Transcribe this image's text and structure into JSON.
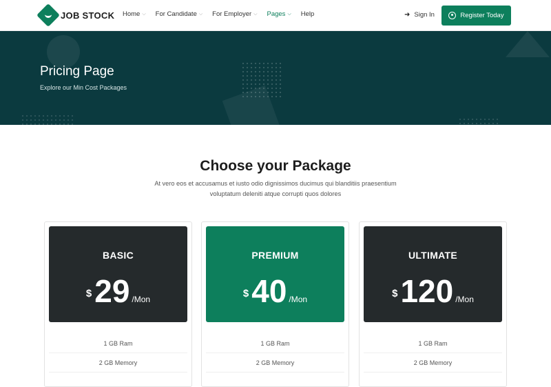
{
  "header": {
    "logo_text": "JOB STOCK",
    "nav": [
      {
        "label": "Home",
        "has_dropdown": true,
        "active": false
      },
      {
        "label": "For Candidate",
        "has_dropdown": true,
        "active": false
      },
      {
        "label": "For Employer",
        "has_dropdown": true,
        "active": false
      },
      {
        "label": "Pages",
        "has_dropdown": true,
        "active": true
      },
      {
        "label": "Help",
        "has_dropdown": false,
        "active": false
      }
    ],
    "signin_label": "Sign In",
    "register_label": "Register Today"
  },
  "hero": {
    "title": "Pricing Page",
    "subtitle": "Explore our Min Cost Packages"
  },
  "section": {
    "title": "Choose your Package",
    "description": "At vero eos et accusamus et iusto odio dignissimos ducimus qui blanditiis praesentium voluptatum deleniti atque corrupti quos dolores"
  },
  "plans": [
    {
      "name": "BASIC",
      "currency": "$",
      "price": "29",
      "period": "/Mon",
      "features": [
        "1 GB Ram",
        "2 GB Memory"
      ]
    },
    {
      "name": "PREMIUM",
      "currency": "$",
      "price": "40",
      "period": "/Mon",
      "features": [
        "1 GB Ram",
        "2 GB Memory"
      ]
    },
    {
      "name": "ULTIMATE",
      "currency": "$",
      "price": "120",
      "period": "/Mon",
      "features": [
        "1 GB Ram",
        "2 GB Memory"
      ]
    }
  ],
  "colors": {
    "brand": "#0d7f5c",
    "hero_bg": "#0b3a3f",
    "dark_card": "#252a2c"
  },
  "icons": {
    "logo": "briefcase-diamond-icon",
    "signin": "sign-in-icon",
    "register": "user-circle-icon",
    "dropdown": "chevron-down-icon"
  }
}
